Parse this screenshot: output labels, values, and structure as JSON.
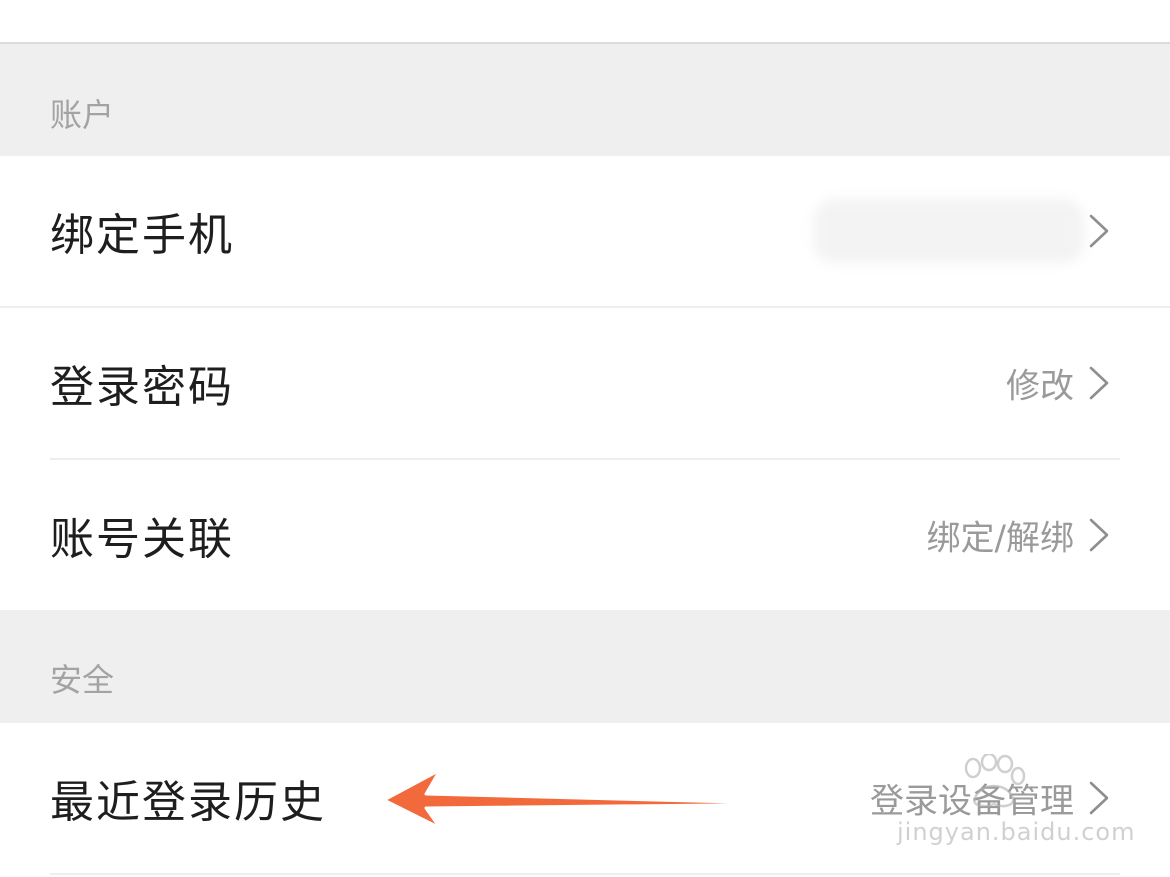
{
  "sections": [
    {
      "header": "账户",
      "rows": [
        {
          "title": "绑定手机",
          "value": ""
        },
        {
          "title": "登录密码",
          "value": "修改"
        },
        {
          "title": "账号关联",
          "value": "绑定/解绑"
        }
      ]
    },
    {
      "header": "安全",
      "rows": [
        {
          "title": "最近登录历史",
          "value": "登录设备管理"
        }
      ]
    }
  ],
  "annotation": {
    "arrow_color": "#f26a3c",
    "watermark_text": "jingyan.baidu.com"
  },
  "icons": {
    "row_chevron": "chevron-right-icon"
  }
}
